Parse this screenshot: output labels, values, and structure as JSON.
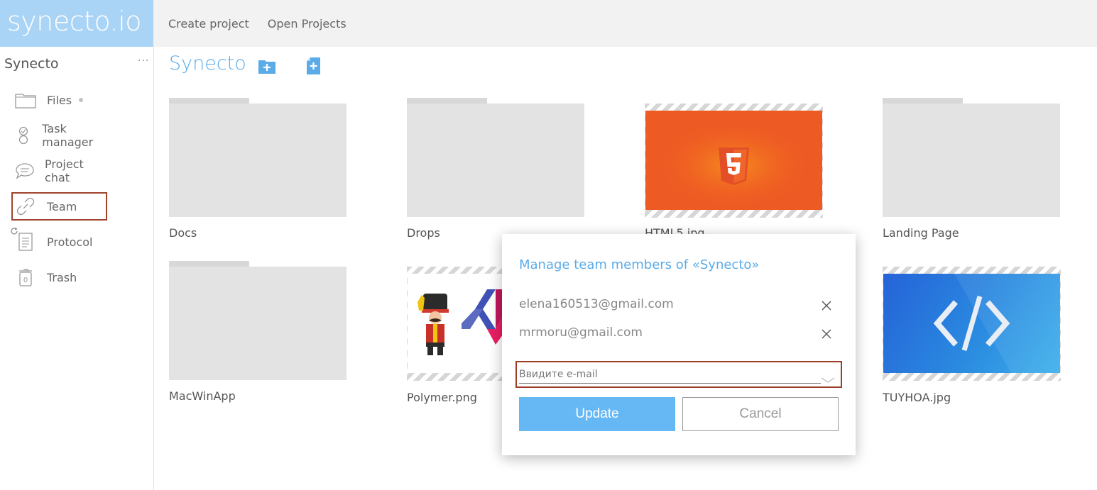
{
  "header": {
    "logo": "synecto.io",
    "nav": [
      "Create project",
      "Open Projects"
    ]
  },
  "sidebar": {
    "project": "Synecto",
    "more": "···",
    "items": [
      {
        "label": "Files",
        "icon": "folder-icon"
      },
      {
        "label": "Task manager",
        "icon": "task-icon"
      },
      {
        "label": "Project chat",
        "icon": "chat-icon"
      },
      {
        "label": "Team",
        "icon": "link-icon",
        "active": true
      },
      {
        "label": "Protocol",
        "icon": "document-icon"
      },
      {
        "label": "Trash",
        "icon": "trash-icon"
      }
    ]
  },
  "main": {
    "title": "Synecto",
    "files": [
      {
        "name": "Docs",
        "kind": "folder"
      },
      {
        "name": "Drops",
        "kind": "folder"
      },
      {
        "name": "HTML5.jpg",
        "kind": "image"
      },
      {
        "name": "Landing Page",
        "kind": "folder"
      },
      {
        "name": "MacWinApp",
        "kind": "folder"
      },
      {
        "name": "Polymer.png",
        "kind": "image"
      },
      {
        "name": "TUYHOA.jpg",
        "kind": "image"
      }
    ],
    "html5_badge": "HTML",
    "html5_num": "5"
  },
  "modal": {
    "title": "Manage team members of «Synecto»",
    "members": [
      "elena160513@gmail.com",
      "mrmoru@gmail.com"
    ],
    "email_placeholder": "Ввидите e-mail",
    "update_label": "Update",
    "cancel_label": "Cancel"
  },
  "colors": {
    "brand": "#aad4f5",
    "accent": "#5aabe8",
    "button": "#66b8f5",
    "highlight_border": "#9e3d2a",
    "html5_bg": "#ee5a23"
  }
}
